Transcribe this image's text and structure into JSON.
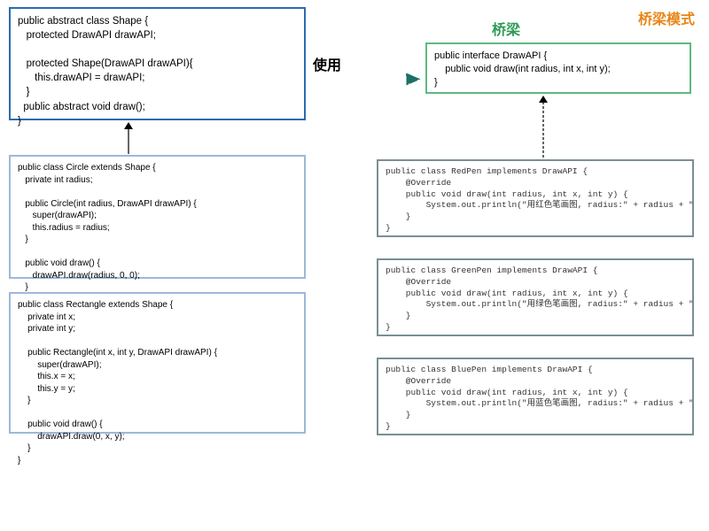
{
  "title_pattern": "桥梁模式",
  "label_bridge": "桥梁",
  "label_use": "使用",
  "shape_code": "public abstract class Shape {\n   protected DrawAPI drawAPI;\n\n   protected Shape(DrawAPI drawAPI){\n      this.drawAPI = drawAPI;\n   }\n  public abstract void draw();\n}",
  "circle_code": "public class Circle extends Shape {\n   private int radius;\n\n   public Circle(int radius, DrawAPI drawAPI) {\n      super(drawAPI);\n      this.radius = radius;\n   }\n\n   public void draw() {\n      drawAPI.draw(radius, 0, 0);\n   }\n}",
  "rectangle_code": "public class Rectangle extends Shape {\n    private int x;\n    private int y;\n\n    public Rectangle(int x, int y, DrawAPI drawAPI) {\n        super(drawAPI);\n        this.x = x;\n        this.y = y;\n    }\n\n    public void draw() {\n        drawAPI.draw(0, x, y);\n    }\n}",
  "drawapi_code": "public interface DrawAPI {\n    public void draw(int radius, int x, int y);\n}",
  "redpen_code": "public class RedPen implements DrawAPI {\n    @Override\n    public void draw(int radius, int x, int y) {\n        System.out.println(\"用红色笔画图, radius:\" + radius + \", x:\"…\n    }\n}",
  "greenpen_code": "public class GreenPen implements DrawAPI {\n    @Override\n    public void draw(int radius, int x, int y) {\n        System.out.println(\"用绿色笔画图, radius:\" + radius + \", x:\"…\n    }\n}",
  "bluepen_code": "public class BluePen implements DrawAPI {\n    @Override\n    public void draw(int radius, int x, int y) {\n        System.out.println(\"用蓝色笔画图, radius:\" + radius + \", x:\"…\n    }\n}"
}
